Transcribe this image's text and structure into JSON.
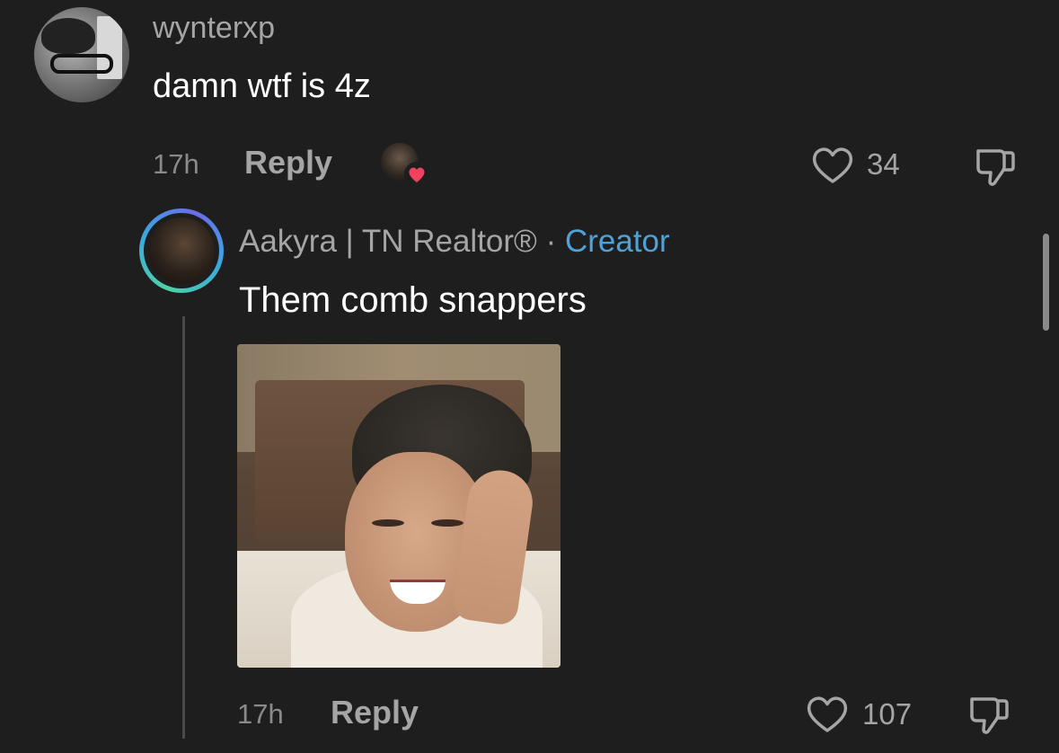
{
  "top_comment": {
    "username": "wynterxp",
    "text": "damn wtf is 4z",
    "time": "17h",
    "reply_label": "Reply",
    "like_count": "34"
  },
  "reply_comment": {
    "username": "Aakyra | TN Realtor®",
    "separator": "·",
    "badge": "Creator",
    "text": "Them comb snappers",
    "time": "17h",
    "reply_label": "Reply",
    "like_count": "107"
  },
  "colors": {
    "background": "#1e1e1e",
    "creator_badge": "#4da3d8",
    "heart_badge": "#f0415f"
  },
  "icons": [
    "heart-outline-icon",
    "thumbs-down-icon",
    "heart-badge-icon"
  ]
}
